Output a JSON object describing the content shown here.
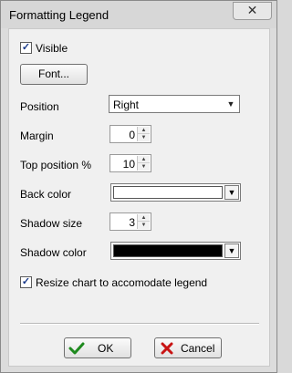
{
  "window": {
    "title": "Formatting Legend",
    "close_label": "✕"
  },
  "visible": {
    "label": "Visible",
    "checked": true
  },
  "font_button": {
    "label": "Font..."
  },
  "position": {
    "label": "Position",
    "value": "Right"
  },
  "margin": {
    "label": "Margin",
    "value": "0"
  },
  "top_position": {
    "label": "Top position %",
    "value": "10"
  },
  "back_color": {
    "label": "Back color",
    "color": "#ffffff"
  },
  "shadow_size": {
    "label": "Shadow size",
    "value": "3"
  },
  "shadow_color": {
    "label": "Shadow color",
    "color": "#000000"
  },
  "resize": {
    "label": "Resize chart to accomodate legend",
    "checked": true
  },
  "buttons": {
    "ok_label": "OK",
    "cancel_label": "Cancel"
  },
  "colors": {
    "ok_check": "#1e8a1e",
    "cancel_x": "#c81414"
  }
}
